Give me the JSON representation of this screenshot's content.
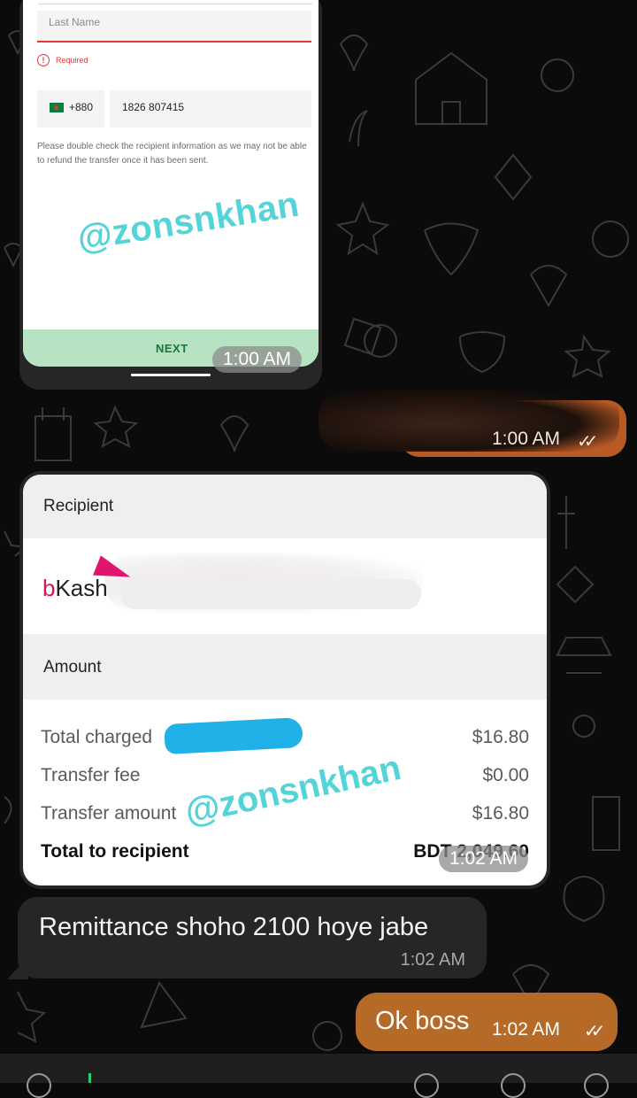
{
  "form_screenshot": {
    "last_name_placeholder": "Last Name",
    "required_text": "Required",
    "country_code": "+880",
    "phone_number": "1826 807415",
    "notice": "Please double check the recipient information as we may not be able to refund the transfer once it has been sent.",
    "watermark": "@zonsnkhan",
    "next_label": "NEXT",
    "time": "1:00 AM"
  },
  "blurred_message": {
    "time": "1:00 AM"
  },
  "recipient_card": {
    "recipient_header": "Recipient",
    "provider_logo_b": "b",
    "provider_logo_rest": "Kash",
    "amount_header": "Amount",
    "rows": [
      {
        "label": "Total charged",
        "value": "$16.80"
      },
      {
        "label": "Transfer fee",
        "value": "$0.00"
      },
      {
        "label": "Transfer amount",
        "value": "$16.80"
      },
      {
        "label": "Total to recipient",
        "value": "BDT 2,049.60"
      }
    ],
    "watermark": "@zonsnkhan",
    "time": "1:02 AM"
  },
  "incoming_message": {
    "text": "Remittance shoho 2100 hoye jabe",
    "time": "1:02 AM"
  },
  "outgoing_message": {
    "text": "Ok boss",
    "time": "1:02 AM"
  },
  "colors": {
    "outgoing_bubble": "#b66a28",
    "incoming_bubble": "#262626",
    "error_red": "#e0393e",
    "next_button": "#b8e3c2",
    "watermark": "#52d4d8"
  }
}
